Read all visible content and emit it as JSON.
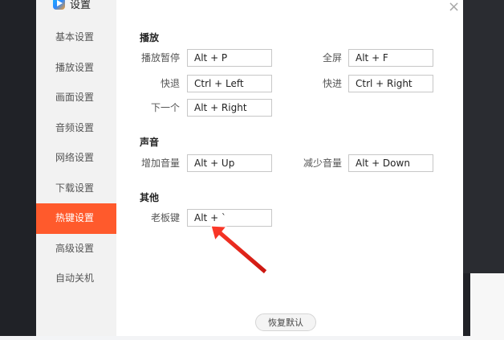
{
  "dialog": {
    "title": "设置",
    "close_icon": "close-icon"
  },
  "sidebar": {
    "items": [
      {
        "label": "基本设置",
        "active": false
      },
      {
        "label": "播放设置",
        "active": false
      },
      {
        "label": "画面设置",
        "active": false
      },
      {
        "label": "音频设置",
        "active": false
      },
      {
        "label": "网络设置",
        "active": false
      },
      {
        "label": "下载设置",
        "active": false
      },
      {
        "label": "热键设置",
        "active": true
      },
      {
        "label": "高级设置",
        "active": false
      },
      {
        "label": "自动关机",
        "active": false
      }
    ]
  },
  "sections": {
    "playback": {
      "title": "播放",
      "play_pause_label": "播放暂停",
      "play_pause_value": "Alt + P",
      "fullscreen_label": "全屏",
      "fullscreen_value": "Alt + F",
      "rewind_label": "快退",
      "rewind_value": "Ctrl + Left",
      "forward_label": "快进",
      "forward_value": "Ctrl + Right",
      "next_label": "下一个",
      "next_value": "Alt + Right"
    },
    "audio": {
      "title": "声音",
      "volume_up_label": "增加音量",
      "volume_up_value": "Alt + Up",
      "volume_down_label": "减少音量",
      "volume_down_value": "Alt + Down"
    },
    "other": {
      "title": "其他",
      "boss_key_label": "老板键",
      "boss_key_value": "Alt + `"
    }
  },
  "footer": {
    "restore_label": "恢复默认"
  },
  "colors": {
    "accent": "#ff5a2c",
    "arrow": "#e8231b"
  }
}
